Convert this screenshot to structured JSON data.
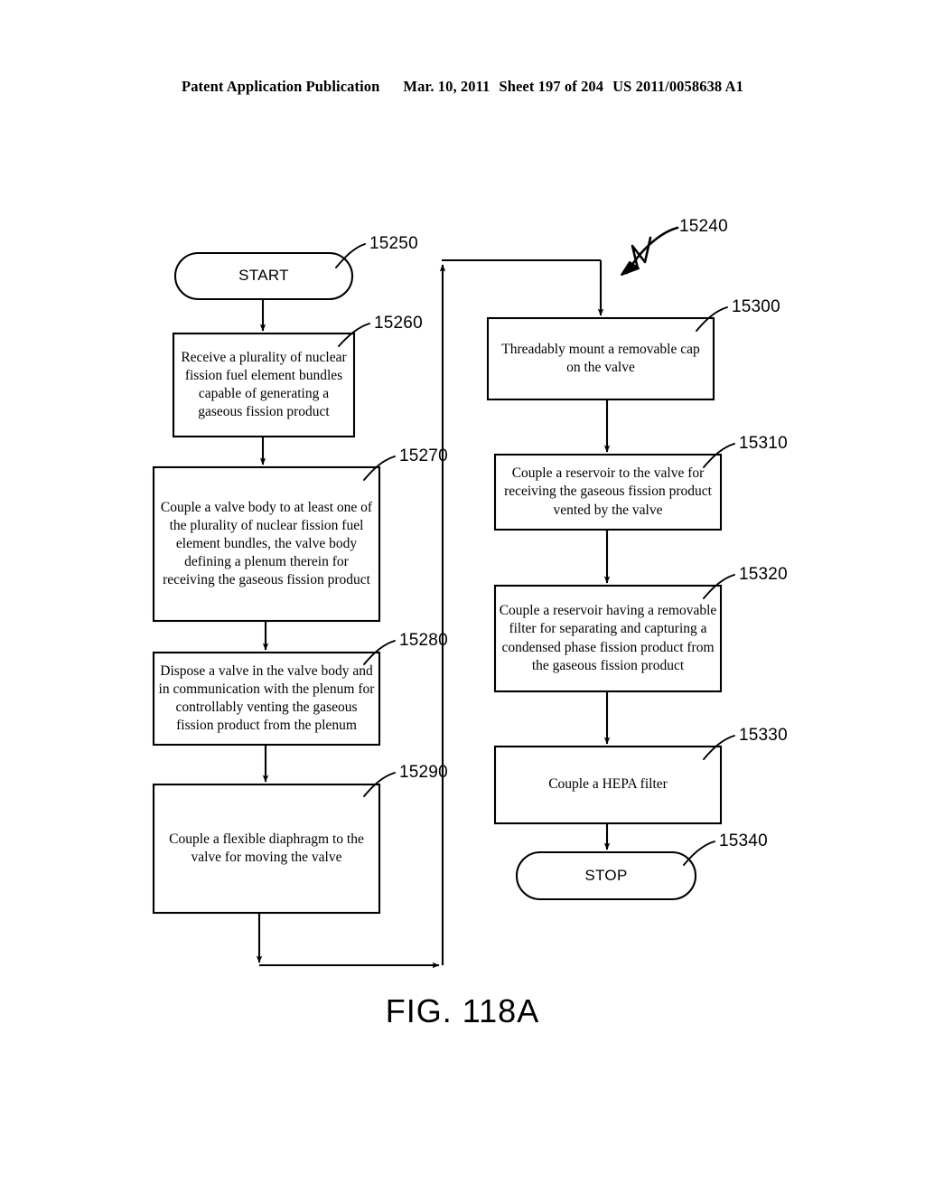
{
  "header": {
    "publication": "Patent Application Publication",
    "date": "Mar. 10, 2011",
    "sheet": "Sheet 197 of 204",
    "patent_number": "US 2011/0058638 A1"
  },
  "figure": {
    "caption": "FIG. 118A",
    "diagram_ref": "15240"
  },
  "nodes": {
    "start": {
      "label": "START",
      "ref": "15250"
    },
    "n15260": {
      "label": "Receive a plurality of nuclear fission fuel element bundles capable of generating a gaseous fission product",
      "ref": "15260"
    },
    "n15270": {
      "label": "Couple a valve body to at least one of the plurality of nuclear fission fuel element bundles, the valve body defining a plenum therein for receiving the gaseous fission product",
      "ref": "15270"
    },
    "n15280": {
      "label": "Dispose a valve in the valve body and in communication with the plenum for controllably venting the gaseous fission product from the plenum",
      "ref": "15280"
    },
    "n15290": {
      "label": "Couple a flexible diaphragm to the valve for moving the valve",
      "ref": "15290"
    },
    "n15300": {
      "label": "Threadably mount a removable cap on the valve",
      "ref": "15300"
    },
    "n15310": {
      "label": "Couple a reservoir to the valve for receiving the gaseous fission product vented by the valve",
      "ref": "15310"
    },
    "n15320": {
      "label": "Couple a reservoir having a removable filter for separating and capturing a condensed phase fission product from the gaseous fission product",
      "ref": "15320"
    },
    "n15330": {
      "label": "Couple a HEPA filter",
      "ref": "15330"
    },
    "stop": {
      "label": "STOP",
      "ref": "15340"
    }
  },
  "colors": {
    "ink": "#000000",
    "paper": "#ffffff"
  }
}
